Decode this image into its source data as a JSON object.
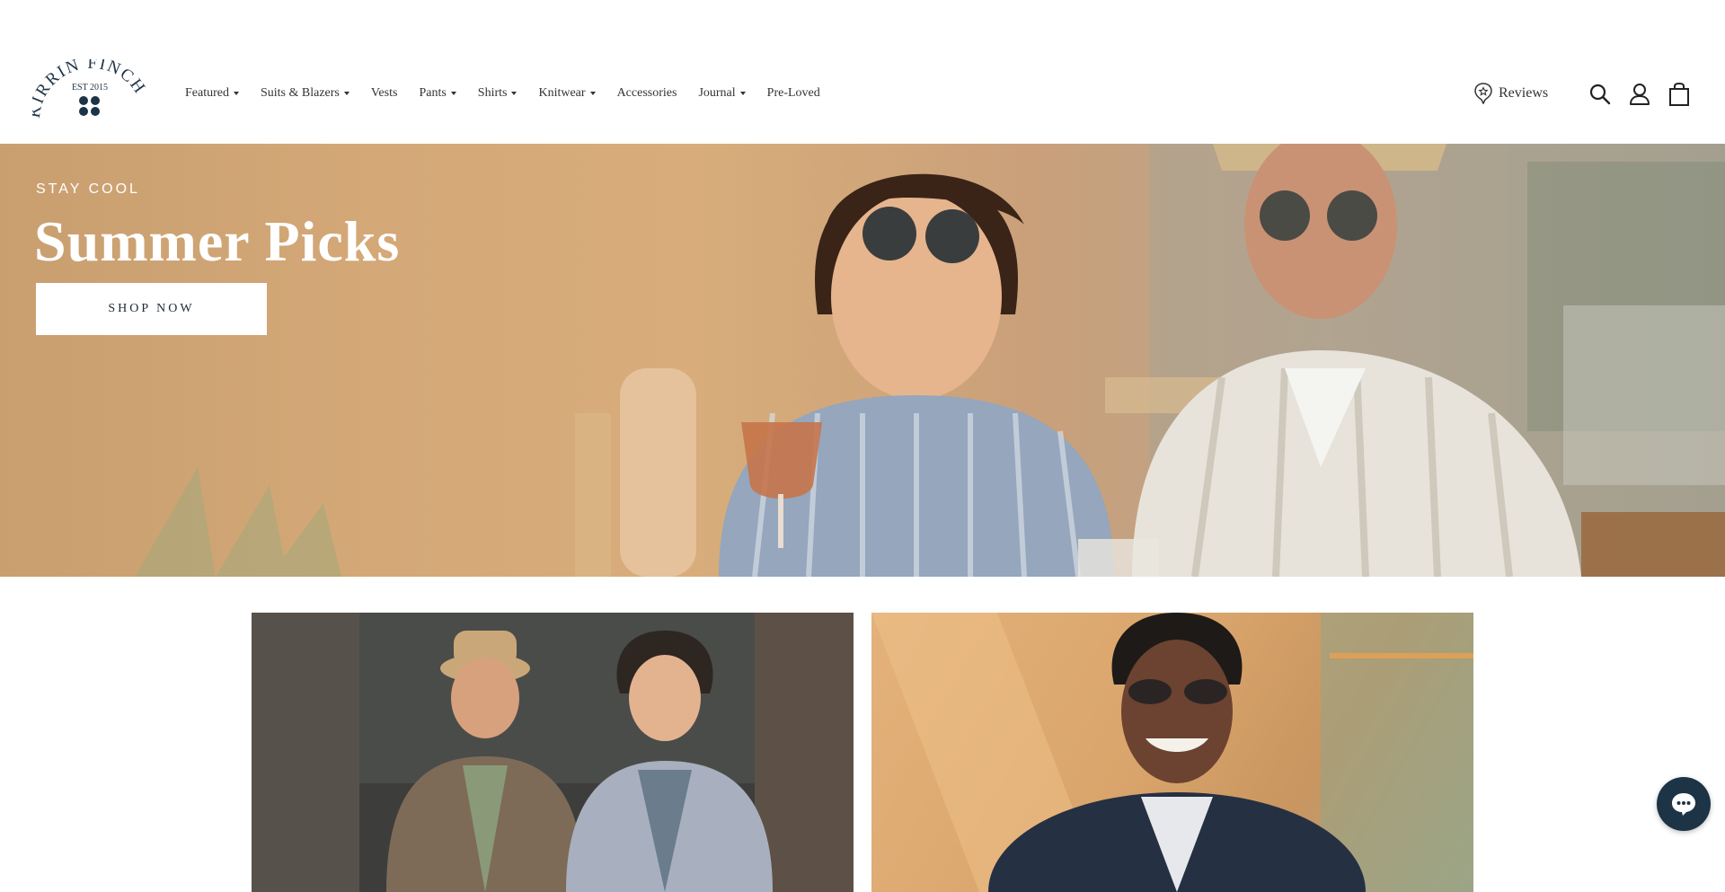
{
  "brand": {
    "name": "KIRRIN FINCH",
    "established": "EST 2015",
    "color": "#1d3346"
  },
  "nav": {
    "items": [
      {
        "label": "Featured",
        "has_dropdown": true
      },
      {
        "label": "Suits & Blazers",
        "has_dropdown": true
      },
      {
        "label": "Vests",
        "has_dropdown": false
      },
      {
        "label": "Pants",
        "has_dropdown": true
      },
      {
        "label": "Shirts",
        "has_dropdown": true
      },
      {
        "label": "Knitwear",
        "has_dropdown": true
      },
      {
        "label": "Accessories",
        "has_dropdown": false
      },
      {
        "label": "Journal",
        "has_dropdown": true
      },
      {
        "label": "Pre-Loved",
        "has_dropdown": false
      }
    ]
  },
  "header": {
    "reviews_label": "Reviews",
    "icons": [
      "reviews-badge-icon",
      "search-icon",
      "account-icon",
      "cart-icon"
    ]
  },
  "hero": {
    "eyebrow": "STAY COOL",
    "title": "Summer Picks",
    "cta_label": "SHOP NOW"
  },
  "chat": {
    "icon": "chat-bubble-icon"
  }
}
